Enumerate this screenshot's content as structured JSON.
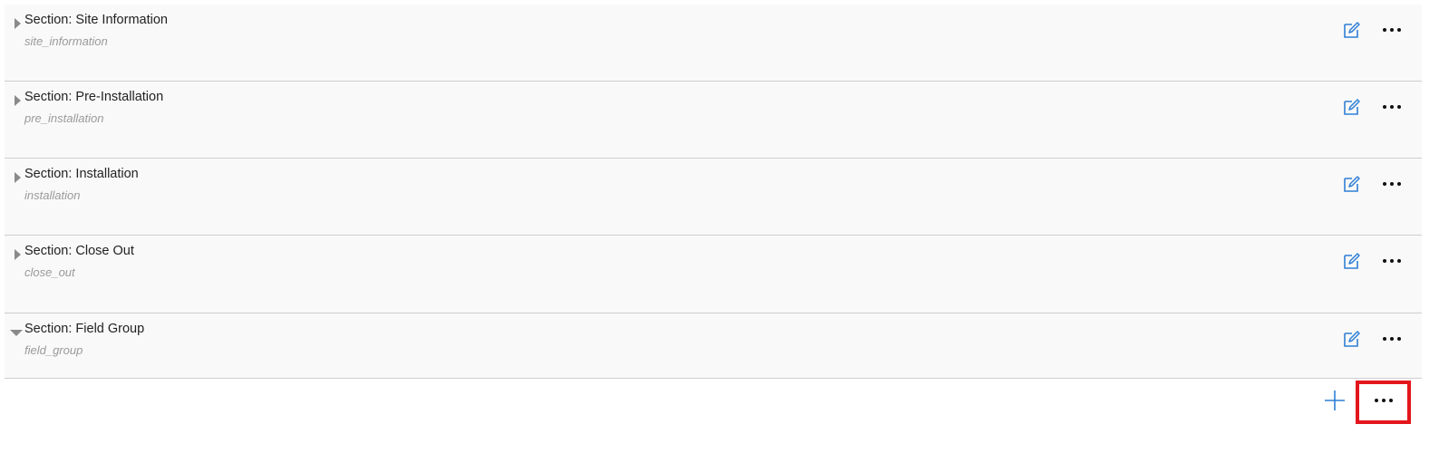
{
  "sections": [
    {
      "title": "Section: Site Information",
      "key": "site_information",
      "expanded": false
    },
    {
      "title": "Section: Pre-Installation",
      "key": "pre_installation",
      "expanded": false
    },
    {
      "title": "Section: Installation",
      "key": "installation",
      "expanded": false
    },
    {
      "title": "Section: Close Out",
      "key": "close_out",
      "expanded": false
    },
    {
      "title": "Section: Field Group",
      "key": "field_group",
      "expanded": true
    }
  ],
  "icons": {
    "toggle_collapsed": "chevron-right-icon",
    "toggle_expanded": "chevron-down-icon",
    "edit": "edit-icon",
    "more": "more-horizontal-icon",
    "add": "plus-icon"
  },
  "colors": {
    "accent_blue": "#2f7fd6",
    "highlight_red": "#e3161c",
    "row_background": "#f9f9f9",
    "caret_gray": "#8a8a8a"
  }
}
